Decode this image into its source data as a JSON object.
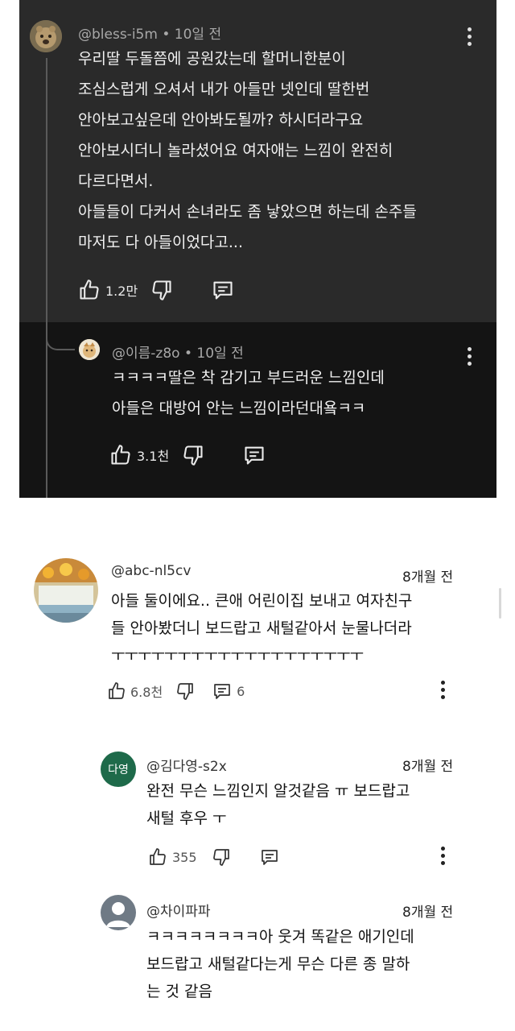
{
  "comments": [
    {
      "author": "@bless-i5m",
      "time": "10일 전",
      "lines": [
        "우리딸 두돌쯤에 공원갔는데 할머니한분이",
        "조심스럽게 오셔서 내가 아들만 넷인데 딸한번",
        "안아보고싶은데 안아봐도될까? 하시더라구요",
        "안아보시더니 놀라셨어요 여자애는 느낌이 완전히",
        "다르다면서.",
        "아들들이 다커서 손녀라도 좀 낳았으면 하는데 손주들",
        "마저도 다 아들이었다고..."
      ],
      "likes": "1.2만",
      "replies": ""
    },
    {
      "author": "@이름-z8o",
      "time": "10일 전",
      "lines": [
        "ㅋㅋㅋㅋ딸은 착 감기고 부드러운 느낌인데",
        "아들은 대방어 안는 느낌이라던대욬ㅋㅋ"
      ],
      "likes": "3.1천",
      "replies": ""
    },
    {
      "author": "@abc-nl5cv",
      "time": "8개월 전",
      "lines": [
        "아들 둘이에요.. 큰애 어린이집 보내고 여자친구",
        "들 안아봤더니 보드랍고 새털같아서 눈물나더라",
        "ㅜㅜㅜㅜㅜㅜㅜㅜㅜㅜㅜㅜㅜㅜㅜㅜㅜㅜㅜ"
      ],
      "likes": "6.8천",
      "replies": "6"
    },
    {
      "author": "@김다영-s2x",
      "avatar_text": "다영",
      "time": "8개월 전",
      "lines": [
        "완전 무슨 느낌인지 알것같음 ㅠ 보드랍고",
        "새털 후우 ㅜ"
      ],
      "likes": "355",
      "replies": ""
    },
    {
      "author": "@차이파파",
      "time": "8개월 전",
      "lines": [
        "ㅋㅋㅋㅋㅋㅋㅋㅋ아 웃겨 똑같은 애기인데",
        "보드랍고 새털같다는게 무슨 다른 종 말하",
        "는 것 같음"
      ],
      "likes": "",
      "replies": ""
    }
  ],
  "icons": {
    "like": "thumbs-up-icon",
    "dislike": "thumbs-down-icon",
    "reply": "reply-comment-icon",
    "more": "more-vertical-icon",
    "default_avatar": "person-icon"
  },
  "colors": {
    "dark_bg": "#2a2a2a",
    "dark_reply_bg": "#141414",
    "avatar_green": "#1e6a4a",
    "avatar_gray": "#6f7a85"
  }
}
